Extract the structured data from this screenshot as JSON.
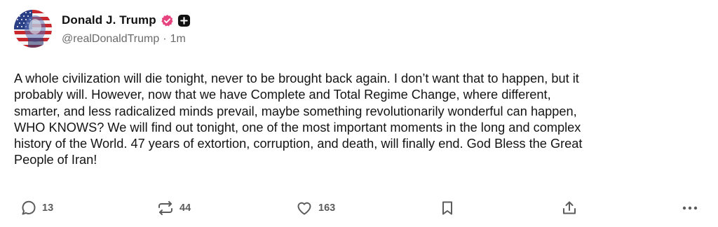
{
  "author": {
    "display_name": "Donald J. Trump",
    "handle": "@realDonaldTrump",
    "separator": "·",
    "time": "1m",
    "avatar_icon": "flag-portrait-avatar",
    "verified_icon": "verified-badge-icon",
    "follow_icon": "plus-icon",
    "verified_color": "#e6447f"
  },
  "post": {
    "text": "A whole civilization will die tonight, never to be brought back again. I don’t want that to happen, but it\nprobably will. However, now that we have Complete and Total Regime Change, where different,\nsmarter, and less radicalized minds prevail, maybe something revolutionarily wonderful can happen,\nWHO KNOWS? We will find out tonight, one of the most important moments in the long and complex\nhistory of the World. 47 years of extortion, corruption, and death, will finally end. God Bless the Great\nPeople of Iran!"
  },
  "actions": {
    "reply": {
      "icon": "reply-icon",
      "count": "13"
    },
    "repost": {
      "icon": "repost-icon",
      "count": "44"
    },
    "like": {
      "icon": "heart-icon",
      "count": "163"
    },
    "bookmark": {
      "icon": "bookmark-icon"
    },
    "share": {
      "icon": "share-icon"
    },
    "more": {
      "icon": "more-icon"
    }
  }
}
